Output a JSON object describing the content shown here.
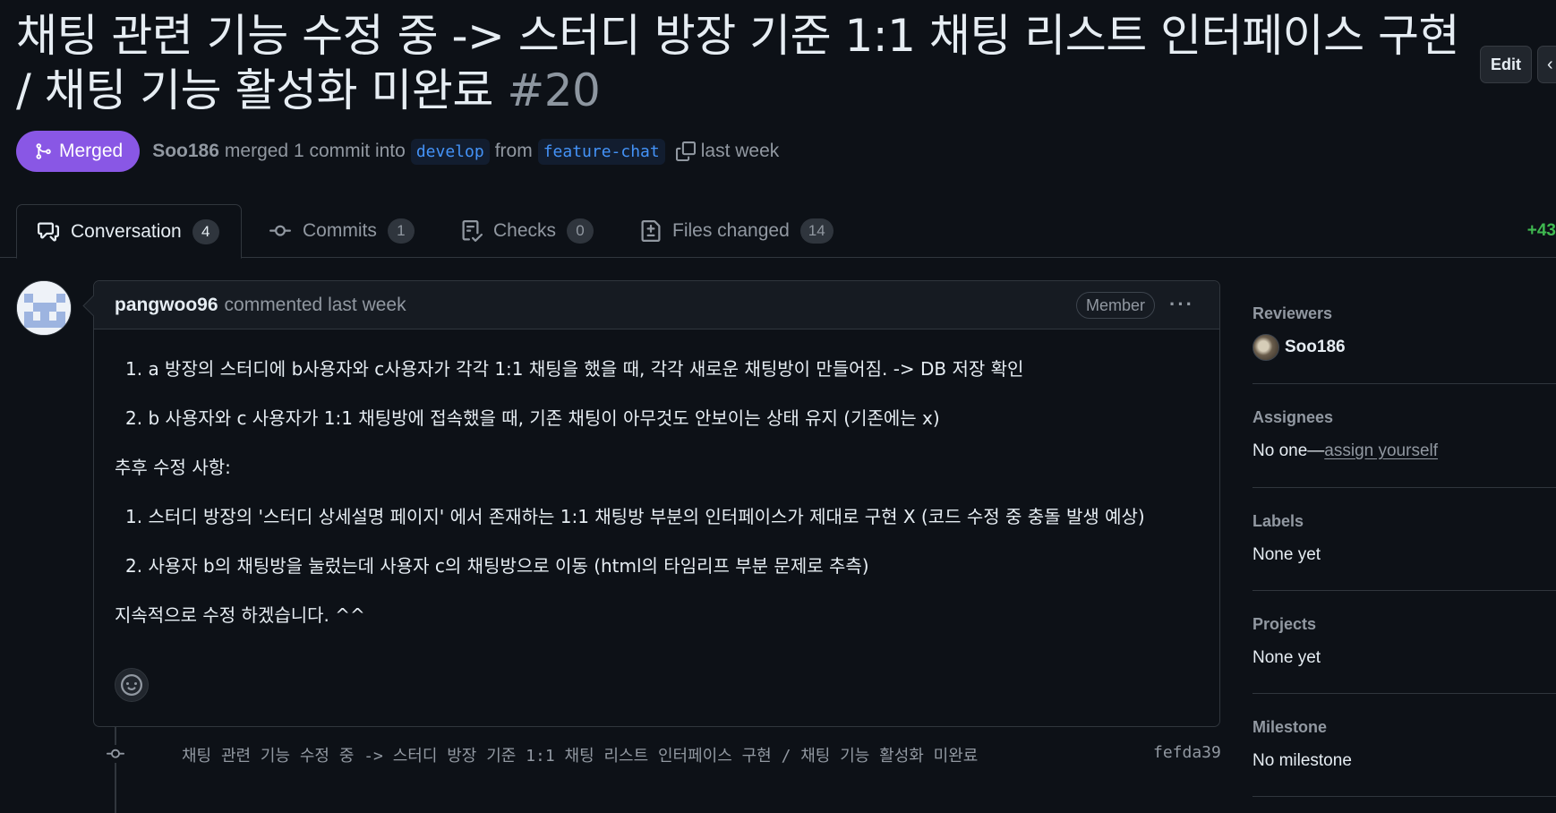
{
  "header": {
    "title": "채팅 관련 기능 수정 중 -> 스터디 방장 기준 1:1 채팅 리스트 인터페이스 구현 / 채팅 기능 활성화 미완료",
    "number": "#20",
    "edit_label": "Edit"
  },
  "meta": {
    "status": "Merged",
    "author": "Soo186",
    "action": "merged 1 commit into",
    "base_branch": "develop",
    "from_text": "from",
    "head_branch": "feature-chat",
    "time": "last week"
  },
  "tabs": [
    {
      "label": "Conversation",
      "count": "4",
      "icon": "comment-discussion-icon",
      "active": true
    },
    {
      "label": "Commits",
      "count": "1",
      "icon": "commit-icon",
      "active": false
    },
    {
      "label": "Checks",
      "count": "0",
      "icon": "checklist-icon",
      "active": false
    },
    {
      "label": "Files changed",
      "count": "14",
      "icon": "file-diff-icon",
      "active": false
    }
  ],
  "diffstat": "+43",
  "comment": {
    "author": "pangwoo96",
    "action": "commented last week",
    "role_badge": "Member",
    "body": {
      "list1": [
        "1. a 방장의 스터디에 b사용자와 c사용자가 각각 1:1 채팅을 했을 때, 각각 새로운 채팅방이 만들어짐. -> DB 저장 확인",
        "2. b 사용자와 c 사용자가 1:1 채팅방에 접속했을 때, 기존 채팅이 아무것도 안보이는 상태 유지 (기존에는 x)"
      ],
      "subheading": "추후 수정 사항:",
      "list2": [
        "1. 스터디 방장의 '스터디 상세설명 페이지' 에서 존재하는 1:1 채팅방 부분의 인터페이스가 제대로 구현 X (코드 수정 중 충돌 발생 예상)",
        "2. 사용자 b의 채팅방을 눌렀는데 사용자 c의 채팅방으로 이동 (html의 타임리프 부분 문제로 추측)"
      ],
      "closing": "지속적으로 수정 하겠습니다. ^^"
    }
  },
  "timeline_commit": {
    "message": "채팅 관련 기능 수정 중 -> 스터디 방장 기준 1:1 채팅 리스트 인터페이스 구현 / 채팅 기능 활성화 미완료",
    "sha": "fefda39"
  },
  "sidebar": {
    "reviewers": {
      "heading": "Reviewers",
      "name": "Soo186"
    },
    "assignees": {
      "heading": "Assignees",
      "none": "No one—",
      "link": "assign yourself"
    },
    "labels": {
      "heading": "Labels",
      "value": "None yet"
    },
    "projects": {
      "heading": "Projects",
      "value": "None yet"
    },
    "milestone": {
      "heading": "Milestone",
      "value": "No milestone"
    }
  },
  "colors": {
    "background": "#0d1117",
    "merged": "#8957e5",
    "link_blue": "#4493f8",
    "addition_green": "#3fb950"
  }
}
